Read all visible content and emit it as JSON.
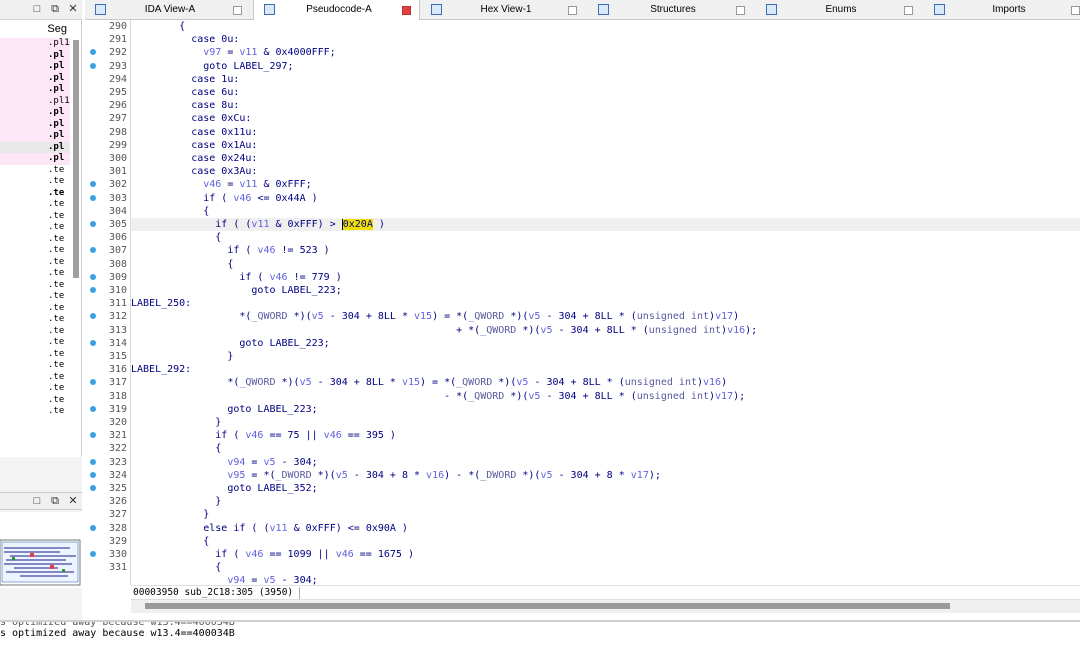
{
  "left_panel": {
    "segments_header": "Seg",
    "segments": [
      ".pl1",
      ".pl",
      ".pl",
      ".pl",
      ".pl",
      ".pl1",
      ".pl",
      ".pl",
      ".pl",
      ".pl",
      ".pl",
      ".te",
      ".te",
      ".te",
      ".te",
      ".te",
      ".te",
      ".te",
      ".te",
      ".te",
      ".te",
      ".te",
      ".te",
      ".te",
      ".te",
      ".te",
      ".te",
      ".te",
      ".te",
      ".te",
      ".te",
      ".te",
      ".te"
    ]
  },
  "tabs": [
    {
      "label": "IDA View-A",
      "active": false
    },
    {
      "label": "Pseudocode-A",
      "active": true
    },
    {
      "label": "Hex View-1",
      "active": false
    },
    {
      "label": "Structures",
      "active": false
    },
    {
      "label": "Enums",
      "active": false
    },
    {
      "label": "Imports",
      "active": false
    }
  ],
  "code": {
    "lines": [
      {
        "n": "290",
        "dot": false,
        "t": "        {"
      },
      {
        "n": "291",
        "dot": false,
        "t": "          case 0u:"
      },
      {
        "n": "292",
        "dot": true,
        "t": "            v97 = v11 & 0x4000FFF;"
      },
      {
        "n": "293",
        "dot": true,
        "t": "            goto LABEL_297;"
      },
      {
        "n": "294",
        "dot": false,
        "t": "          case 1u:"
      },
      {
        "n": "295",
        "dot": false,
        "t": "          case 6u:"
      },
      {
        "n": "296",
        "dot": false,
        "t": "          case 8u:"
      },
      {
        "n": "297",
        "dot": false,
        "t": "          case 0xCu:"
      },
      {
        "n": "298",
        "dot": false,
        "t": "          case 0x11u:"
      },
      {
        "n": "299",
        "dot": false,
        "t": "          case 0x1Au:"
      },
      {
        "n": "300",
        "dot": false,
        "t": "          case 0x24u:"
      },
      {
        "n": "301",
        "dot": false,
        "t": "          case 0x3Au:"
      },
      {
        "n": "302",
        "dot": true,
        "t": "            v46 = v11 & 0xFFF;"
      },
      {
        "n": "303",
        "dot": true,
        "t": "            if ( v46 <= 0x44A )"
      },
      {
        "n": "304",
        "dot": false,
        "t": "            {"
      },
      {
        "n": "305",
        "dot": true,
        "t": "              if ( (v11 & 0xFFF) > 0x20A )",
        "hl": true
      },
      {
        "n": "306",
        "dot": false,
        "t": "              {"
      },
      {
        "n": "307",
        "dot": true,
        "t": "                if ( v46 != 523 )"
      },
      {
        "n": "308",
        "dot": false,
        "t": "                {"
      },
      {
        "n": "309",
        "dot": true,
        "t": "                  if ( v46 != 779 )"
      },
      {
        "n": "310",
        "dot": true,
        "t": "                    goto LABEL_223;"
      },
      {
        "n": "311",
        "dot": false,
        "t": "LABEL_250:"
      },
      {
        "n": "312",
        "dot": true,
        "t": "                  *(_QWORD *)(v5 - 304 + 8LL * v15) = *(_QWORD *)(v5 - 304 + 8LL * (unsigned int)v17)"
      },
      {
        "n": "313",
        "dot": false,
        "t": "                                                      + *(_QWORD *)(v5 - 304 + 8LL * (unsigned int)v16);"
      },
      {
        "n": "314",
        "dot": true,
        "t": "                  goto LABEL_223;"
      },
      {
        "n": "315",
        "dot": false,
        "t": "                }"
      },
      {
        "n": "316",
        "dot": false,
        "t": "LABEL_292:"
      },
      {
        "n": "317",
        "dot": true,
        "t": "                *(_QWORD *)(v5 - 304 + 8LL * v15) = *(_QWORD *)(v5 - 304 + 8LL * (unsigned int)v16)"
      },
      {
        "n": "318",
        "dot": false,
        "t": "                                                    - *(_QWORD *)(v5 - 304 + 8LL * (unsigned int)v17);"
      },
      {
        "n": "319",
        "dot": true,
        "t": "                goto LABEL_223;"
      },
      {
        "n": "320",
        "dot": false,
        "t": "              }"
      },
      {
        "n": "321",
        "dot": true,
        "t": "              if ( v46 == 75 || v46 == 395 )"
      },
      {
        "n": "322",
        "dot": false,
        "t": "              {"
      },
      {
        "n": "323",
        "dot": true,
        "t": "                v94 = v5 - 304;"
      },
      {
        "n": "324",
        "dot": true,
        "t": "                v95 = *(_DWORD *)(v5 - 304 + 8 * v16) - *(_DWORD *)(v5 - 304 + 8 * v17);"
      },
      {
        "n": "325",
        "dot": true,
        "t": "                goto LABEL_352;"
      },
      {
        "n": "326",
        "dot": false,
        "t": "              }"
      },
      {
        "n": "327",
        "dot": false,
        "t": "            }"
      },
      {
        "n": "328",
        "dot": true,
        "t": "            else if ( (v11 & 0xFFF) <= 0x90A )"
      },
      {
        "n": "329",
        "dot": false,
        "t": "            {"
      },
      {
        "n": "330",
        "dot": true,
        "t": "              if ( v46 == 1099 || v46 == 1675 )"
      },
      {
        "n": "331",
        "dot": false,
        "t": "              {"
      },
      {
        "n": "",
        "dot": false,
        "t": "                v94 = v5 - 304;"
      }
    ]
  },
  "status": {
    "text": "00003950 sub_2C18:305 (3950)"
  },
  "output": {
    "line1": "s optimized away because w13.4==400034B",
    "line2": "s optimized away because w13.4==400034B"
  }
}
